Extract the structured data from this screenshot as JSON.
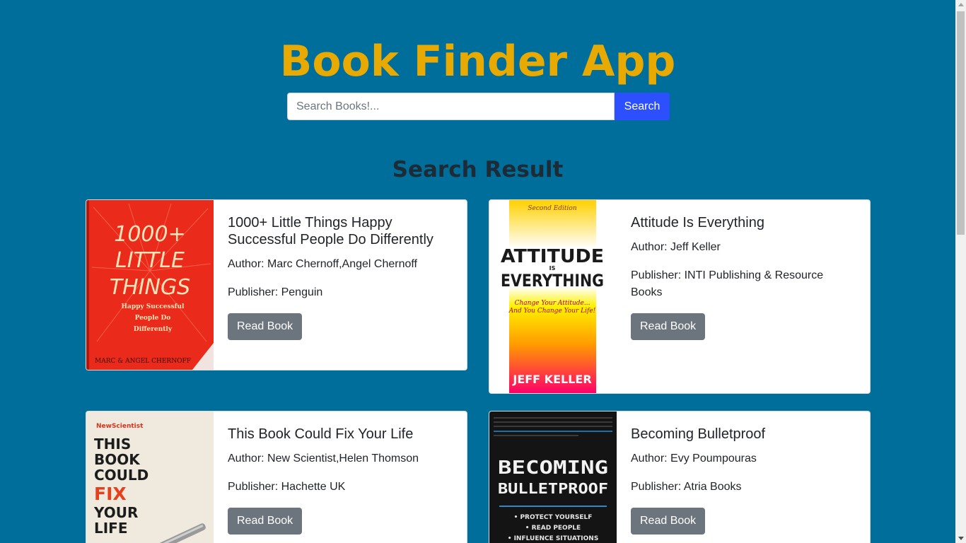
{
  "header": {
    "title": "Book Finder App"
  },
  "search": {
    "placeholder": "Search Books!...",
    "value": "",
    "button_label": "Search"
  },
  "results": {
    "heading": "Search Result",
    "books": [
      {
        "title": "1000+ Little Things Happy Successful People Do Differently",
        "author": "Author: Marc Chernoff,Angel Chernoff",
        "publisher": "Publisher: Penguin",
        "button_label": "Read Book",
        "cover_text": [
          "1000+",
          "LITTLE",
          "THINGS",
          "Happy Successful",
          "People Do",
          "Differently",
          "MARC & ANGEL CHERNOFF"
        ]
      },
      {
        "title": "Attitude Is Everything",
        "author": "Author: Jeff Keller",
        "publisher": "Publisher: INTI Publishing & Resource Books",
        "button_label": "Read Book",
        "cover_text": [
          "Second Edition",
          "ATTITUDE",
          "IS",
          "EVERYTHING",
          "Change Your Attitude...",
          "And You Change Your Life!",
          "JEFF KELLER"
        ]
      },
      {
        "title": "This Book Could Fix Your Life",
        "author": "Author: New Scientist,Helen Thomson",
        "publisher": "Publisher: Hachette UK",
        "button_label": "Read Book",
        "cover_text": [
          "NewScientist",
          "THIS",
          "BOOK",
          "COULD",
          "FIX",
          "YOUR",
          "LIFE"
        ]
      },
      {
        "title": "Becoming Bulletproof",
        "author": "Author: Evy Poumpouras",
        "publisher": "Publisher: Atria Books",
        "button_label": "Read Book",
        "cover_text": [
          "BECOMING",
          "BULLETPROOF",
          "• PROTECT YOURSELF",
          "• READ PEOPLE",
          "• INFLUENCE SITUATIONS"
        ]
      }
    ]
  },
  "colors": {
    "background": "#006e9a",
    "title": "#e8a900",
    "search_button": "#2c50ff",
    "read_button": "#6c757d"
  }
}
